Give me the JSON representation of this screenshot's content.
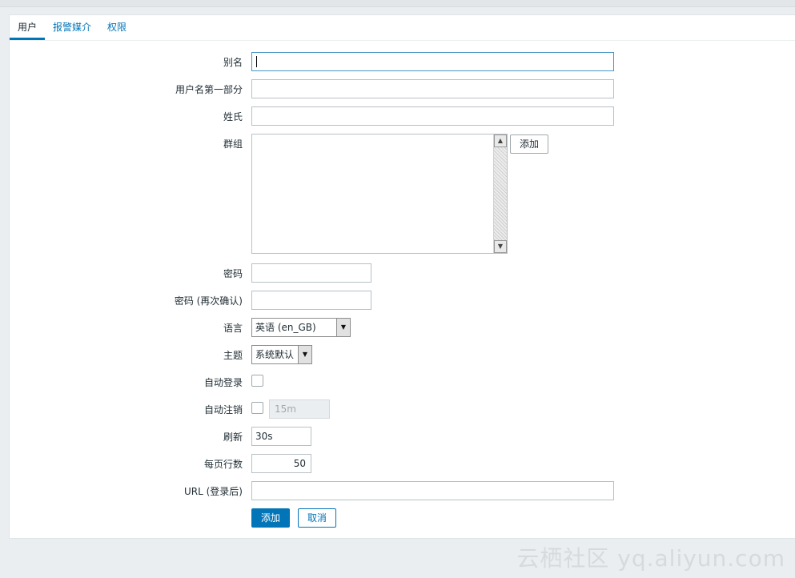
{
  "tabs": [
    {
      "label": "用户",
      "active": true
    },
    {
      "label": "报警媒介",
      "active": false
    },
    {
      "label": "权限",
      "active": false
    }
  ],
  "form": {
    "alias_label": "别名",
    "alias_value": "",
    "name_label": "用户名第一部分",
    "name_value": "",
    "surname_label": "姓氏",
    "surname_value": "",
    "groups_label": "群组",
    "groups_add_button": "添加",
    "password_label": "密码",
    "password_confirm_label": "密码 (再次确认)",
    "language_label": "语言",
    "language_value": "英语 (en_GB)",
    "theme_label": "主题",
    "theme_value": "系统默认",
    "autologin_label": "自动登录",
    "autologin_checked": false,
    "autologout_label": "自动注销",
    "autologout_checked": false,
    "autologout_value": "15m",
    "refresh_label": "刷新",
    "refresh_value": "30s",
    "rows_per_page_label": "每页行数",
    "rows_per_page_value": "50",
    "url_label": "URL (登录后)",
    "url_value": ""
  },
  "actions": {
    "add_label": "添加",
    "cancel_label": "取消"
  },
  "watermark": "云栖社区 yq.aliyun.com",
  "colors": {
    "accent": "#0275b8",
    "background": "#ebeef0"
  }
}
